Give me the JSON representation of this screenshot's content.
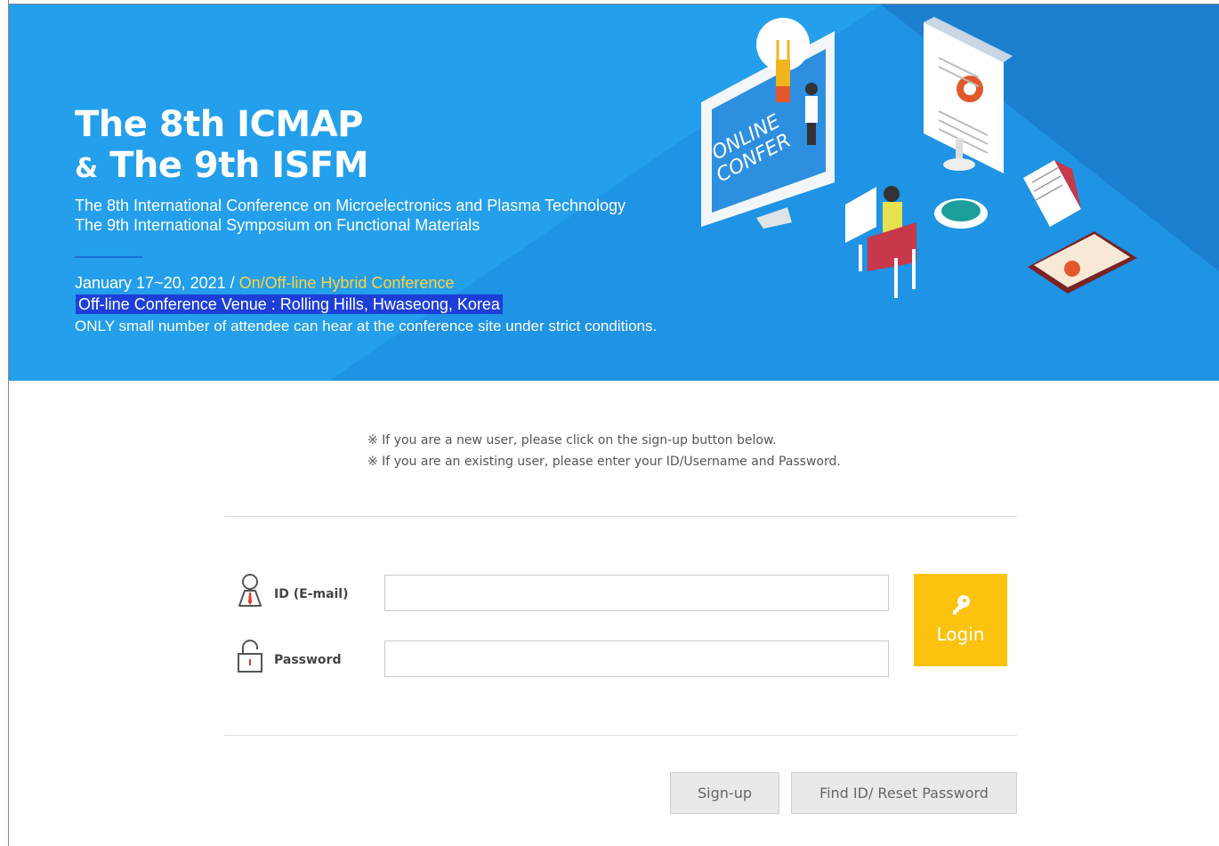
{
  "banner": {
    "title_line1": "The 8th ICMAP",
    "title_amp": "&",
    "title_line2": "The 9th ISFM",
    "subtitle_line1": "The 8th International Conference on Microelectronics and Plasma Technology",
    "subtitle_line2": "The 9th International Symposium on Functional Materials",
    "date_text": "January 17~20, 2021 / ",
    "hybrid_text": "On/Off-line Hybrid Conference",
    "venue_text": "Off-line Conference Venue : Rolling Hills, Hwaseong, Korea",
    "notice_text": "ONLY small number of attendee can hear at the conference site under strict conditions.",
    "illustration_text": "ONLINE CONFER",
    "colors": {
      "background": "#239fec",
      "hybrid": "#ffd23a",
      "venue_highlight": "#1d3fd8"
    }
  },
  "info": {
    "line1": "※ If you are a new user, please click on the sign-up button below.",
    "line2": "※ If you are an existing user, please enter your ID/Username and Password."
  },
  "form": {
    "id_label": "ID (E-mail)",
    "id_value": "",
    "id_icon": "user-icon",
    "password_label": "Password",
    "password_value": "",
    "password_icon": "lock-icon",
    "login_label": "Login",
    "login_icon": "key-icon",
    "login_color": "#fbc30d"
  },
  "buttons": {
    "signup_label": "Sign-up",
    "find_label": "Find ID/ Reset Password"
  }
}
